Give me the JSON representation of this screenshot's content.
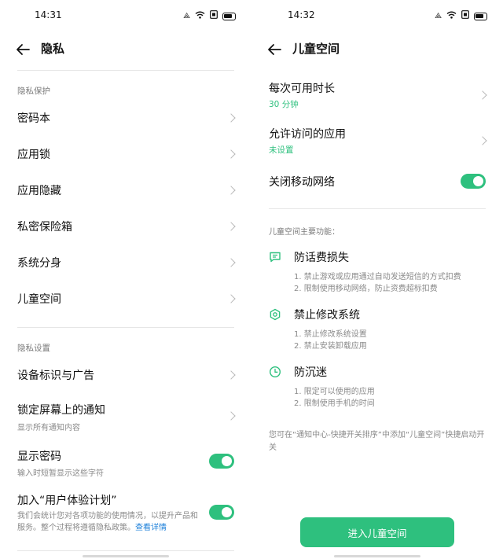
{
  "left": {
    "status": {
      "time": "14:31"
    },
    "header": {
      "title": "隐私"
    },
    "privacy_protection": {
      "label": "隐私保护",
      "items": [
        {
          "label": "密码本"
        },
        {
          "label": "应用锁"
        },
        {
          "label": "应用隐藏"
        },
        {
          "label": "私密保险箱"
        },
        {
          "label": "系统分身"
        },
        {
          "label": "儿童空间"
        }
      ]
    },
    "privacy_settings": {
      "label": "隐私设置",
      "device_ads": "设备标识与广告",
      "lock_notify": {
        "label": "锁定屏幕上的通知",
        "sub": "显示所有通知内容"
      },
      "show_password": {
        "label": "显示密码",
        "sub": "输入时短暂显示这些字符",
        "enabled": true
      },
      "ux_plan": {
        "label": "加入“用户体验计划”",
        "desc": "我们会统计您对各项功能的使用情况，以提升产品和服务。整个过程将遵循隐私政策。",
        "link": "查看详情",
        "enabled": true
      }
    }
  },
  "right": {
    "status": {
      "time": "14:32"
    },
    "header": {
      "title": "儿童空间"
    },
    "time_limit": {
      "label": "每次可用时长",
      "value": "30 分钟"
    },
    "allowed_apps": {
      "label": "允许访问的应用",
      "value": "未设置"
    },
    "close_mobile": {
      "label": "关闭移动网络",
      "enabled": true
    },
    "features_heading": "儿童空间主要功能：",
    "features": [
      {
        "icon": "message-icon",
        "title": "防话费损失",
        "lines": [
          "1. 禁止游戏或应用通过自动发送短信的方式扣费",
          "2. 限制使用移动网络，防止资费超标扣费"
        ]
      },
      {
        "icon": "settings-hex-icon",
        "title": "禁止修改系统",
        "lines": [
          "1. 禁止修改系统设置",
          "2. 禁止安装卸载应用"
        ]
      },
      {
        "icon": "clock-icon",
        "title": "防沉迷",
        "lines": [
          "1. 限定可以使用的应用",
          "2. 限制使用手机的时间"
        ]
      }
    ],
    "footer_note": "您可在“通知中心-快捷开关排序”中添加“儿童空间”快捷启动开关",
    "enter_button": "进入儿童空间"
  },
  "colors": {
    "accent": "#2ec07e",
    "link": "#1b7fd9"
  }
}
